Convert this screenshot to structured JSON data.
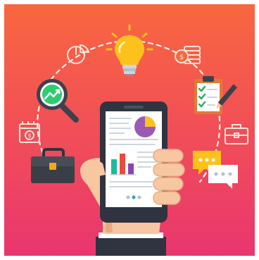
{
  "colors": {
    "bg_top": "#f9673f",
    "bg_bottom": "#e9366f",
    "outline_icons": "#ffe2d8",
    "dashed_arc": "#fff3ee",
    "phone_body": "#2f3440",
    "phone_screen": "#ffffff",
    "skin": "#f7c7a1",
    "skin_shadow": "#e9a981",
    "bulb": "#fcc21b",
    "bulb_base": "#cfd5de",
    "magnifier_ring": "#3b424c",
    "magnifier_glass": "#2ecc71",
    "briefcase": "#3a3f47",
    "briefcase_trim": "#f5a623",
    "clipboard": "#e07b39",
    "check_green": "#27ae60",
    "chat_yellow": "#fcc21b",
    "chat_white": "#ffffff",
    "chart_purple": "#9b59b6",
    "chart_yellow": "#fcc21b",
    "bar_teal": "#1abc9c",
    "bar_red": "#e74c3c",
    "bar_purple": "#8e44ad",
    "sleeve": "#2f3440"
  },
  "icons": [
    "pie-chart-outline-icon",
    "light-bulb-icon",
    "coin-stack-outline-icon",
    "magnifier-growth-icon",
    "clipboard-checklist-icon",
    "money-cash-outline-icon",
    "briefcase-outline-icon",
    "briefcase-icon",
    "chat-bubbles-icon",
    "smartphone-icon",
    "hand-icon"
  ],
  "phone_screen": {
    "pie_fill_fraction": 0.25,
    "bar_values": [
      0.55,
      0.75,
      0.4
    ],
    "active_page_dot": 1,
    "page_dots": 3
  }
}
